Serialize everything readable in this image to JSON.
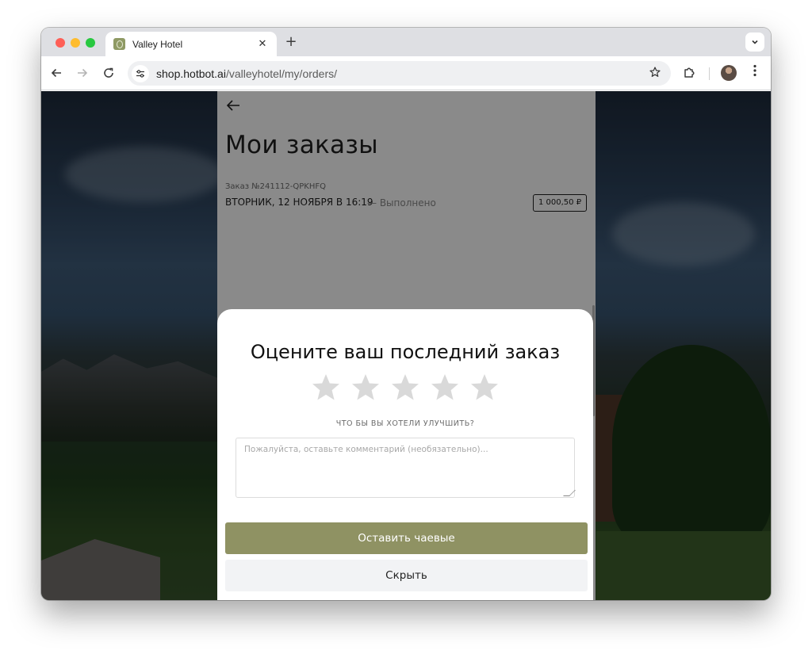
{
  "browser": {
    "tab_title": "Valley Hotel",
    "tab_close": "✕",
    "new_tab": "+",
    "url_host": "shop.hotbot.ai",
    "url_path": "/valleyhotel/my/orders/",
    "icons": {
      "back": "arrow-left-icon",
      "forward": "arrow-right-icon",
      "reload": "reload-icon",
      "site_info": "tune-icon",
      "bookmark": "star-outline-icon",
      "extensions": "puzzle-icon",
      "menu": "more-vertical-icon",
      "tab_list": "chevron-down-icon"
    }
  },
  "page": {
    "title": "Мои заказы",
    "order": {
      "number_label": "Заказ №241112-QPKHFQ",
      "date": "ВТОРНИК, 12 НОЯБРЯ В 16:19",
      "status": "— Выполнено",
      "price": "1 000,50 ₽"
    }
  },
  "modal": {
    "title": "Оцените ваш последний заказ",
    "rating": {
      "max": 5,
      "value": 0
    },
    "improve_label": "ЧТО БЫ ВЫ ХОТЕЛИ УЛУЧШИТЬ?",
    "comment_placeholder": "Пожалуйста, оставьте комментарий (необязательно)...",
    "tip_button": "Оставить чаевые",
    "hide_button": "Скрыть"
  },
  "colors": {
    "accent": "#8f9263",
    "star_empty": "#d9d9d9",
    "secondary_button": "#f2f3f5"
  }
}
